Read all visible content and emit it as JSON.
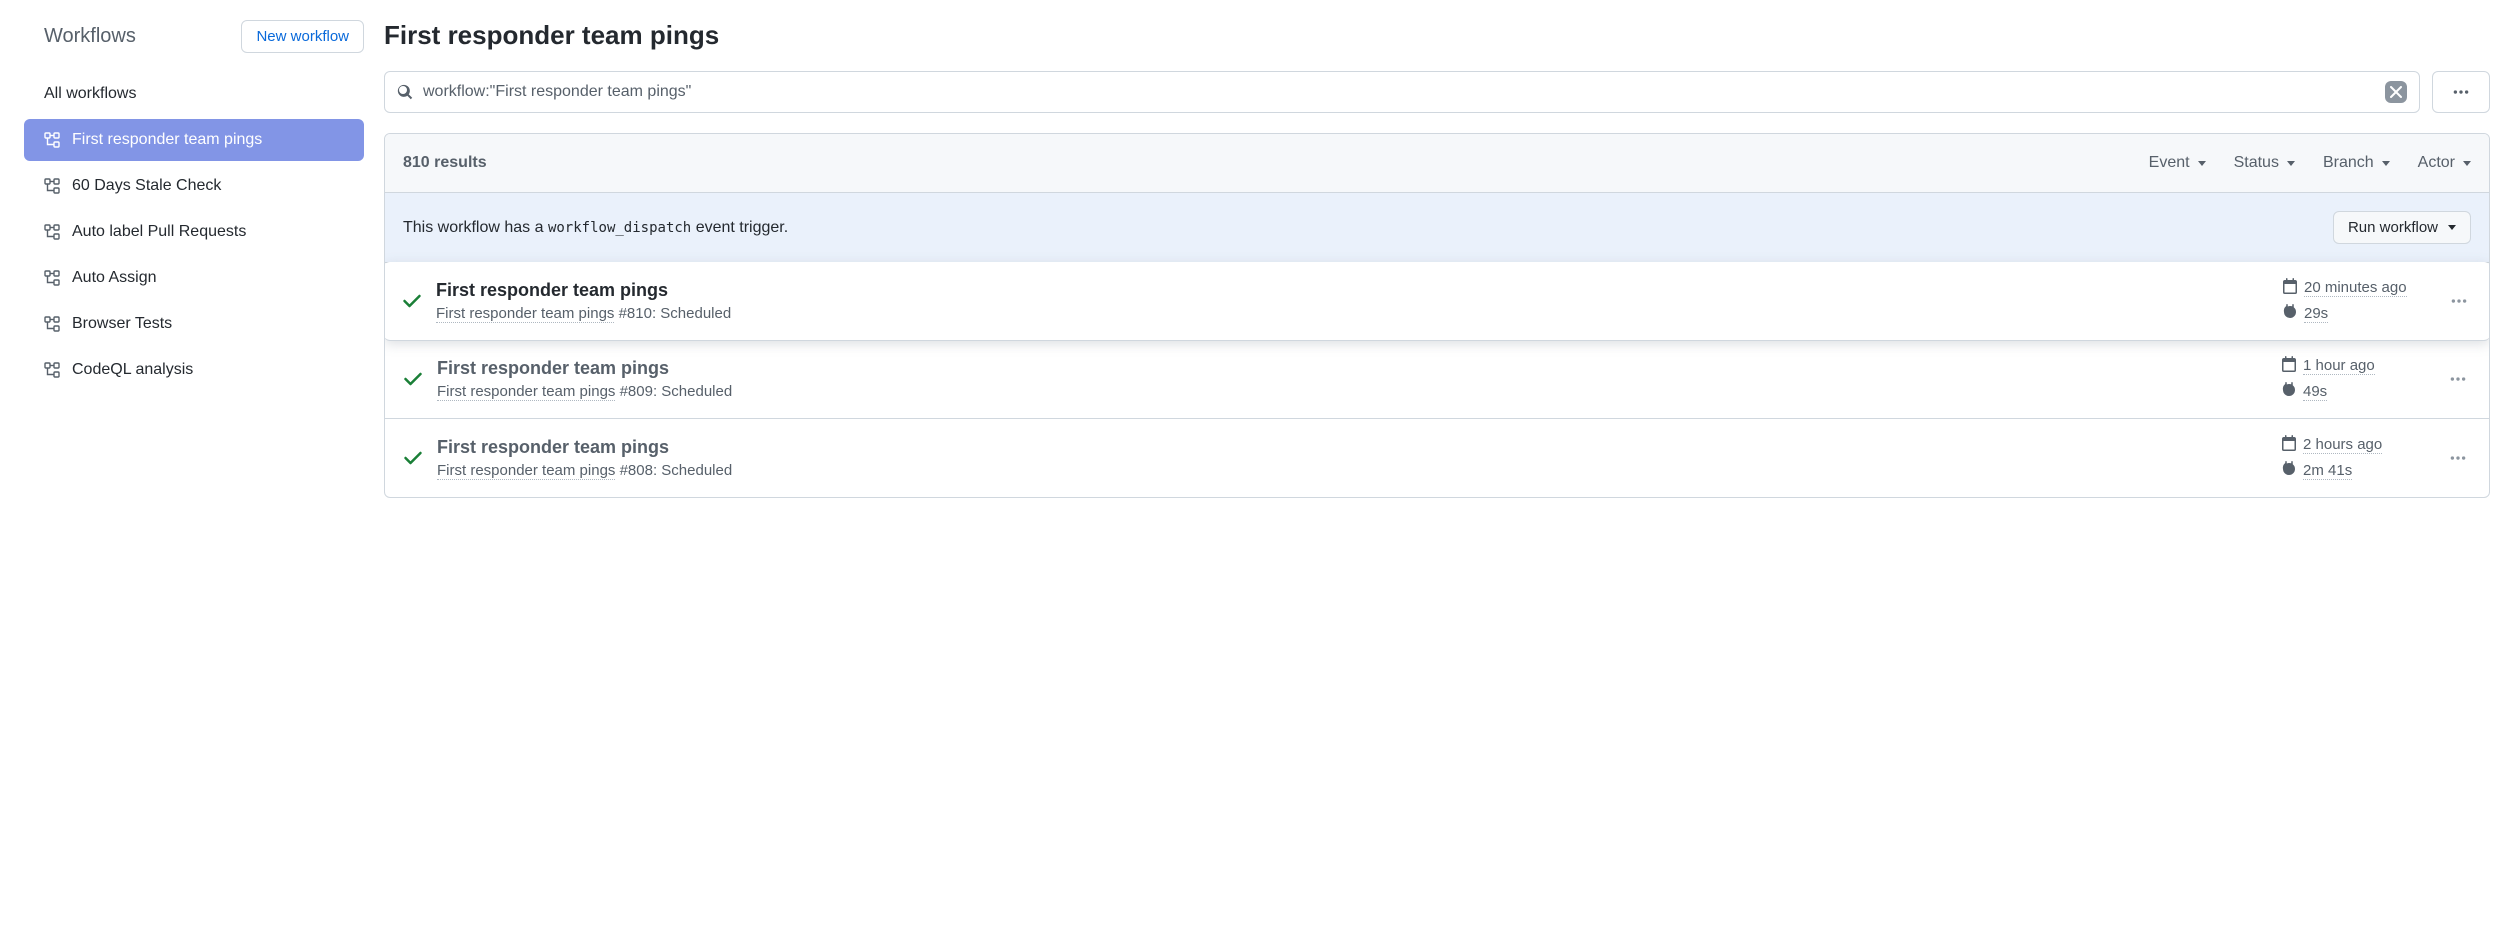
{
  "sidebar": {
    "title": "Workflows",
    "new_workflow_label": "New workflow",
    "all_workflows_label": "All workflows",
    "items": [
      {
        "label": "First responder team pings",
        "active": true
      },
      {
        "label": "60 Days Stale Check",
        "active": false
      },
      {
        "label": "Auto label Pull Requests",
        "active": false
      },
      {
        "label": "Auto Assign",
        "active": false
      },
      {
        "label": "Browser Tests",
        "active": false
      },
      {
        "label": "CodeQL analysis",
        "active": false
      }
    ]
  },
  "main": {
    "page_title": "First responder team pings",
    "search_value": "workflow:\"First responder team pings\"",
    "results_count_label": "810 results",
    "filters": {
      "event": "Event",
      "status": "Status",
      "branch": "Branch",
      "actor": "Actor"
    },
    "dispatch": {
      "prefix": "This workflow has a ",
      "code": "workflow_dispatch",
      "suffix": " event trigger.",
      "button_label": "Run workflow"
    },
    "runs": [
      {
        "title": "First responder team pings",
        "workflow_name": "First responder team pings",
        "run_suffix": " #810: Scheduled",
        "time_ago": "20 minutes ago",
        "duration": "29s",
        "highlighted": true
      },
      {
        "title": "First responder team pings",
        "workflow_name": "First responder team pings",
        "run_suffix": " #809: Scheduled",
        "time_ago": "1 hour ago",
        "duration": "49s",
        "highlighted": false
      },
      {
        "title": "First responder team pings",
        "workflow_name": "First responder team pings",
        "run_suffix": " #808: Scheduled",
        "time_ago": "2 hours ago",
        "duration": "2m 41s",
        "highlighted": false
      }
    ]
  }
}
